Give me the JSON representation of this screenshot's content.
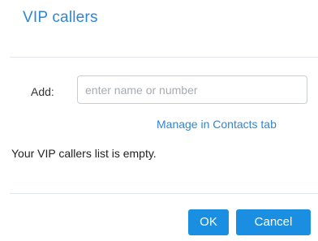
{
  "dialog": {
    "title": "VIP callers",
    "add_label": "Add:",
    "add_input": {
      "value": "",
      "placeholder": "enter name or number"
    },
    "manage_link": "Manage in Contacts tab",
    "empty_message": "Your VIP callers list is empty.",
    "buttons": {
      "ok": "OK",
      "cancel": "Cancel"
    }
  },
  "colors": {
    "accent": "#2f86d3",
    "button": "#1a8ee0"
  }
}
